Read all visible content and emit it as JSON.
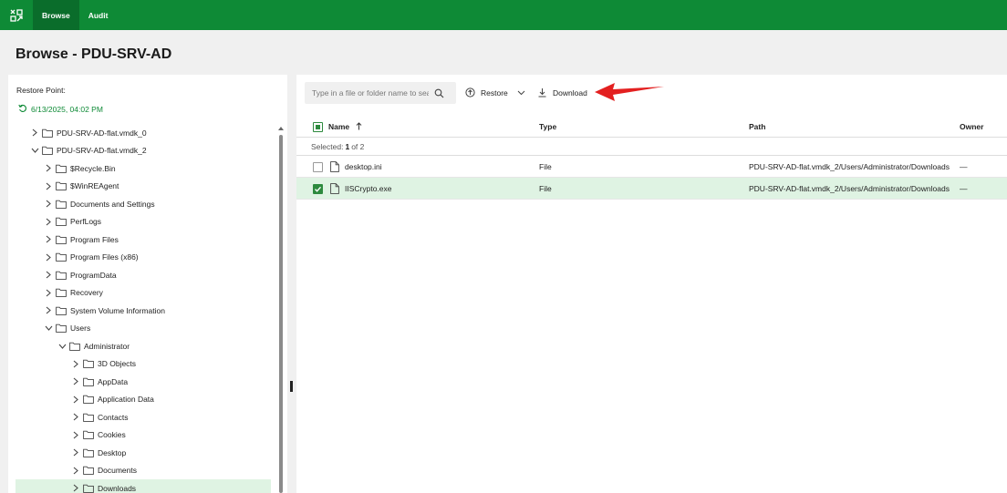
{
  "nav": {
    "browse": "Browse",
    "audit": "Audit"
  },
  "page": {
    "title": "Browse - PDU-SRV-AD"
  },
  "restore_point": {
    "label": "Restore Point:",
    "value": "6/13/2025, 04:02 PM"
  },
  "tree": [
    {
      "label": "PDU-SRV-AD-flat.vmdk_0",
      "level": 0,
      "expanded": false,
      "selected": false
    },
    {
      "label": "PDU-SRV-AD-flat.vmdk_2",
      "level": 0,
      "expanded": true,
      "selected": false
    },
    {
      "label": "$Recycle.Bin",
      "level": 1,
      "expanded": false,
      "selected": false
    },
    {
      "label": "$WinREAgent",
      "level": 1,
      "expanded": false,
      "selected": false
    },
    {
      "label": "Documents and Settings",
      "level": 1,
      "expanded": false,
      "selected": false
    },
    {
      "label": "PerfLogs",
      "level": 1,
      "expanded": false,
      "selected": false
    },
    {
      "label": "Program Files",
      "level": 1,
      "expanded": false,
      "selected": false
    },
    {
      "label": "Program Files (x86)",
      "level": 1,
      "expanded": false,
      "selected": false
    },
    {
      "label": "ProgramData",
      "level": 1,
      "expanded": false,
      "selected": false
    },
    {
      "label": "Recovery",
      "level": 1,
      "expanded": false,
      "selected": false
    },
    {
      "label": "System Volume Information",
      "level": 1,
      "expanded": false,
      "selected": false
    },
    {
      "label": "Users",
      "level": 1,
      "expanded": true,
      "selected": false
    },
    {
      "label": "Administrator",
      "level": 2,
      "expanded": true,
      "selected": false
    },
    {
      "label": "3D Objects",
      "level": 3,
      "expanded": false,
      "selected": false
    },
    {
      "label": "AppData",
      "level": 3,
      "expanded": false,
      "selected": false
    },
    {
      "label": "Application Data",
      "level": 3,
      "expanded": false,
      "selected": false
    },
    {
      "label": "Contacts",
      "level": 3,
      "expanded": false,
      "selected": false
    },
    {
      "label": "Cookies",
      "level": 3,
      "expanded": false,
      "selected": false
    },
    {
      "label": "Desktop",
      "level": 3,
      "expanded": false,
      "selected": false
    },
    {
      "label": "Documents",
      "level": 3,
      "expanded": false,
      "selected": false
    },
    {
      "label": "Downloads",
      "level": 3,
      "expanded": false,
      "selected": true
    }
  ],
  "toolbar": {
    "search_placeholder": "Type in a file or folder name to search",
    "restore_label": "Restore",
    "download_label": "Download"
  },
  "table": {
    "headers": {
      "name": "Name",
      "type": "Type",
      "path": "Path",
      "owner": "Owner"
    },
    "selected_label": "Selected:",
    "selected_count": "1",
    "selected_total": "of 2",
    "rows": [
      {
        "name": "desktop.ini",
        "type": "File",
        "path": "PDU-SRV-AD-flat.vmdk_2/Users/Administrator/Downloads",
        "owner": "—",
        "checked": false
      },
      {
        "name": "IISCrypto.exe",
        "type": "File",
        "path": "PDU-SRV-AD-flat.vmdk_2/Users/Administrator/Downloads",
        "owner": "—",
        "checked": true
      }
    ]
  },
  "colors": {
    "brand": "#0e8a36",
    "selected_bg": "#dff3e3",
    "arrow": "#e32020"
  }
}
